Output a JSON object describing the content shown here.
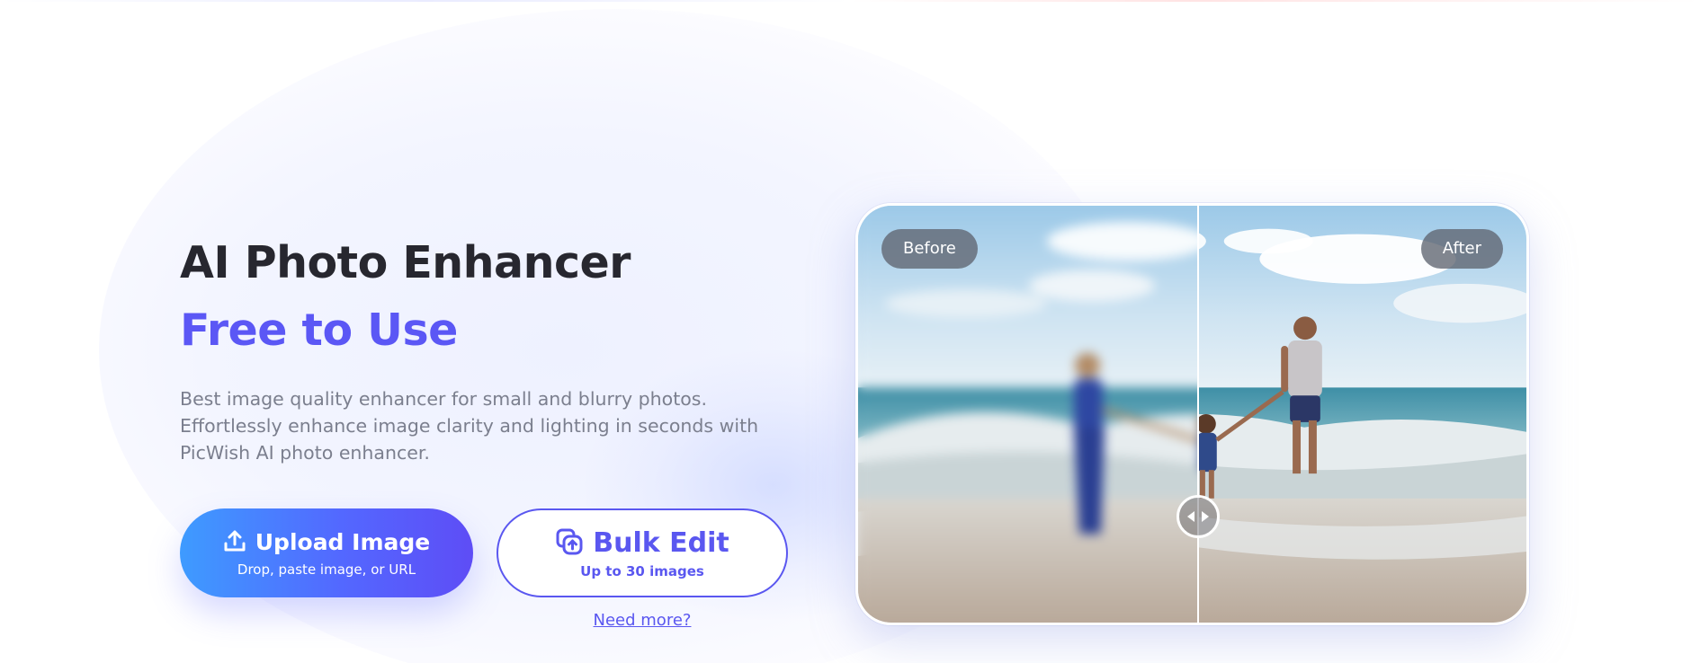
{
  "hero": {
    "title": "AI Photo Enhancer",
    "subtitle": "Free to Use",
    "description": "Best image quality enhancer for small and blurry photos. Effortlessly enhance image clarity and lighting in seconds with PicWish AI photo enhancer."
  },
  "upload_button": {
    "label": "Upload Image",
    "sublabel": "Drop, paste image, or URL",
    "icon": "upload-icon"
  },
  "bulk_button": {
    "label": "Bulk Edit",
    "sublabel": "Up to 30 images",
    "icon": "bulk-copy-icon"
  },
  "need_more_link": "Need more?",
  "compare": {
    "before_label": "Before",
    "after_label": "After",
    "slider_position": 0.5
  },
  "colors": {
    "accent": "#5b57f5",
    "title": "#27272f",
    "body_text": "#7b7f8e",
    "gradient_start": "#3e9bff",
    "gradient_end": "#5e4df6"
  }
}
